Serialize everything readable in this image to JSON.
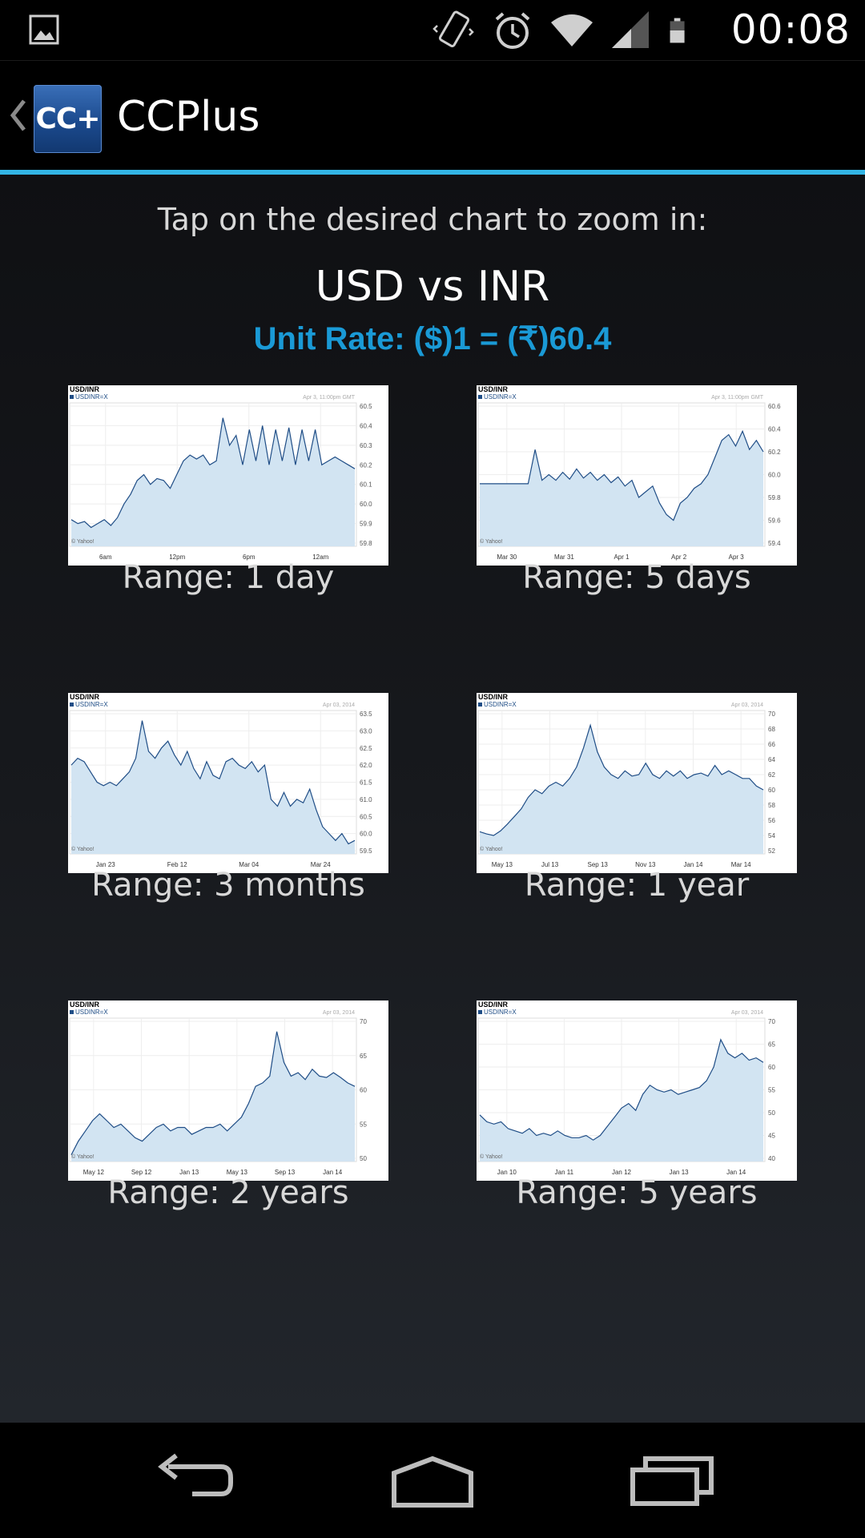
{
  "status_bar": {
    "time": "00:08",
    "icons": [
      "gallery-notification-icon",
      "vibrate-icon",
      "alarm-icon",
      "wifi-icon",
      "signal-icon",
      "battery-icon"
    ]
  },
  "action_bar": {
    "logo_text": "CC+",
    "title": "CCPlus"
  },
  "content": {
    "instruction": "Tap on the desired chart to zoom in:",
    "pair_title": "USD vs INR",
    "unit_rate": "Unit Rate: ($)1 = (₹)60.4"
  },
  "charts": [
    {
      "range_label": "Range: 1 day",
      "title": "USD/INR",
      "legend": "USDINR=X",
      "date_stamp": "Apr 3, 11:00pm GMT",
      "credit": "© Yahoo!",
      "x_labels": [
        "6am",
        "12pm",
        "6pm",
        "12am"
      ],
      "y_labels": [
        "60.5",
        "60.4",
        "60.3",
        "60.2",
        "60.1",
        "60.0",
        "59.9",
        "59.8"
      ],
      "chart_data": {
        "type": "area",
        "ylim": [
          59.8,
          60.5
        ],
        "values": [
          59.92,
          59.9,
          59.91,
          59.88,
          59.9,
          59.92,
          59.89,
          59.93,
          60.0,
          60.05,
          60.12,
          60.15,
          60.1,
          60.13,
          60.12,
          60.08,
          60.15,
          60.22,
          60.25,
          60.23,
          60.25,
          60.2,
          60.22,
          60.44,
          60.3,
          60.35,
          60.2,
          60.38,
          60.22,
          60.4,
          60.2,
          60.38,
          60.22,
          60.39,
          60.2,
          60.38,
          60.22,
          60.38,
          60.2,
          60.22,
          60.24,
          60.22,
          60.2,
          60.18
        ]
      }
    },
    {
      "range_label": "Range: 5 days",
      "title": "USD/INR",
      "legend": "USDINR=X",
      "date_stamp": "Apr 3, 11:00pm GMT",
      "credit": "© Yahoo!",
      "x_labels": [
        "Mar 30",
        "Mar 31",
        "Apr 1",
        "Apr 2",
        "Apr 3"
      ],
      "y_labels": [
        "60.6",
        "60.4",
        "60.2",
        "60.0",
        "59.8",
        "59.6",
        "59.4"
      ],
      "chart_data": {
        "type": "area",
        "ylim": [
          59.4,
          60.6
        ],
        "values": [
          59.92,
          59.92,
          59.92,
          59.92,
          59.92,
          59.92,
          59.92,
          59.92,
          60.22,
          59.95,
          60.0,
          59.95,
          60.02,
          59.96,
          60.05,
          59.97,
          60.02,
          59.95,
          60.0,
          59.93,
          59.98,
          59.9,
          59.95,
          59.8,
          59.85,
          59.9,
          59.75,
          59.65,
          59.6,
          59.75,
          59.8,
          59.88,
          59.92,
          60.0,
          60.15,
          60.3,
          60.35,
          60.25,
          60.38,
          60.22,
          60.3,
          60.2
        ]
      }
    },
    {
      "range_label": "Range: 3 months",
      "title": "USD/INR",
      "legend": "USDINR=X",
      "date_stamp": "Apr 03, 2014",
      "credit": "© Yahoo!",
      "x_labels": [
        "Jan 23",
        "Feb 12",
        "Mar 04",
        "Mar 24"
      ],
      "y_labels": [
        "63.5",
        "63.0",
        "62.5",
        "62.0",
        "61.5",
        "61.0",
        "60.5",
        "60.0",
        "59.5"
      ],
      "chart_data": {
        "type": "area",
        "ylim": [
          59.5,
          63.5
        ],
        "values": [
          62.0,
          62.2,
          62.1,
          61.8,
          61.5,
          61.4,
          61.5,
          61.4,
          61.6,
          61.8,
          62.2,
          63.3,
          62.4,
          62.2,
          62.5,
          62.7,
          62.3,
          62.0,
          62.4,
          61.9,
          61.6,
          62.1,
          61.7,
          61.6,
          62.1,
          62.2,
          62.0,
          61.9,
          62.1,
          61.8,
          62.0,
          61.0,
          60.8,
          61.2,
          60.8,
          61.0,
          60.9,
          61.3,
          60.7,
          60.2,
          60.0,
          59.8,
          60.0,
          59.7,
          59.8
        ]
      }
    },
    {
      "range_label": "Range: 1 year",
      "title": "USD/INR",
      "legend": "USDINR=X",
      "date_stamp": "Apr 03, 2014",
      "credit": "© Yahoo!",
      "x_labels": [
        "May 13",
        "Jul 13",
        "Sep 13",
        "Nov 13",
        "Jan 14",
        "Mar 14"
      ],
      "y_labels": [
        "70",
        "68",
        "66",
        "64",
        "62",
        "60",
        "58",
        "56",
        "54",
        "52"
      ],
      "chart_data": {
        "type": "area",
        "ylim": [
          52,
          70
        ],
        "values": [
          54.5,
          54.2,
          54.0,
          54.6,
          55.5,
          56.5,
          57.5,
          59.0,
          60.0,
          59.5,
          60.5,
          61.0,
          60.5,
          61.5,
          63.0,
          65.5,
          68.5,
          65.0,
          63.0,
          62.0,
          61.5,
          62.5,
          61.8,
          62.0,
          63.5,
          62.0,
          61.5,
          62.5,
          61.8,
          62.5,
          61.5,
          62.0,
          62.2,
          61.8,
          63.2,
          62.0,
          62.5,
          62.0,
          61.5,
          61.5,
          60.5,
          60.0
        ]
      }
    },
    {
      "range_label": "Range: 2 years",
      "title": "USD/INR",
      "legend": "USDINR=X",
      "date_stamp": "Apr 03, 2014",
      "credit": "© Yahoo!",
      "x_labels": [
        "May 12",
        "Sep 12",
        "Jan 13",
        "May 13",
        "Sep 13",
        "Jan 14"
      ],
      "y_labels": [
        "70",
        "65",
        "60",
        "55",
        "50"
      ],
      "chart_data": {
        "type": "area",
        "ylim": [
          50,
          70
        ],
        "values": [
          50.5,
          52.5,
          54.0,
          55.5,
          56.5,
          55.5,
          54.5,
          55.0,
          54.0,
          53.0,
          52.5,
          53.5,
          54.5,
          55.0,
          54.0,
          54.5,
          54.5,
          53.5,
          54.0,
          54.5,
          54.5,
          55.0,
          54.0,
          55.0,
          56.0,
          58.0,
          60.5,
          61.0,
          62.0,
          68.5,
          64.0,
          62.0,
          62.5,
          61.5,
          63.0,
          62.0,
          61.8,
          62.5,
          61.8,
          61.0,
          60.5
        ]
      }
    },
    {
      "range_label": "Range: 5 years",
      "title": "USD/INR",
      "legend": "USDINR=X",
      "date_stamp": "Apr 03, 2014",
      "credit": "© Yahoo!",
      "x_labels": [
        "Jan 10",
        "Jan 11",
        "Jan 12",
        "Jan 13",
        "Jan 14"
      ],
      "y_labels": [
        "70",
        "65",
        "60",
        "55",
        "50",
        "45",
        "40"
      ],
      "chart_data": {
        "type": "area",
        "ylim": [
          40,
          70
        ],
        "values": [
          49.5,
          48.0,
          47.5,
          48.0,
          46.5,
          46.0,
          45.5,
          46.5,
          45.0,
          45.5,
          45.0,
          46.0,
          45.0,
          44.5,
          44.5,
          45.0,
          44.0,
          45.0,
          47.0,
          49.0,
          51.0,
          52.0,
          50.5,
          54.0,
          56.0,
          55.0,
          54.5,
          55.0,
          54.0,
          54.5,
          55.0,
          55.5,
          57.0,
          60.0,
          66.0,
          63.0,
          62.0,
          63.0,
          61.5,
          62.0,
          61.0
        ]
      }
    }
  ],
  "nav_bar": {
    "buttons": [
      "back",
      "home",
      "recents"
    ]
  }
}
